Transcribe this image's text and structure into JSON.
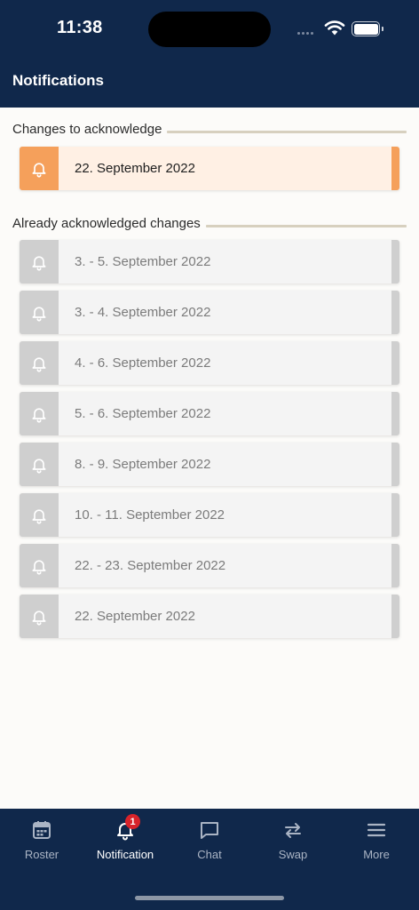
{
  "status_bar": {
    "time": "11:38"
  },
  "header": {
    "title": "Notifications"
  },
  "sections": {
    "pending": {
      "title": "Changes to acknowledge",
      "items": [
        {
          "label": "22. September 2022"
        }
      ]
    },
    "acknowledged": {
      "title": "Already acknowledged changes",
      "items": [
        {
          "label": "3. - 5. September 2022"
        },
        {
          "label": "3. - 4. September 2022"
        },
        {
          "label": "4. - 6. September 2022"
        },
        {
          "label": "5. - 6. September 2022"
        },
        {
          "label": "8. - 9. September 2022"
        },
        {
          "label": "10. - 11. September 2022"
        },
        {
          "label": "22. - 23. September 2022"
        },
        {
          "label": "22. September 2022"
        }
      ]
    }
  },
  "tab_bar": {
    "tabs": [
      {
        "label": "Roster",
        "icon": "calendar-icon",
        "active": false
      },
      {
        "label": "Notification",
        "icon": "bell-icon",
        "active": true,
        "badge": "1"
      },
      {
        "label": "Chat",
        "icon": "chat-bubble-icon",
        "active": false
      },
      {
        "label": "Swap",
        "icon": "swap-arrows-icon",
        "active": false
      },
      {
        "label": "More",
        "icon": "menu-icon",
        "active": false
      }
    ]
  },
  "colors": {
    "navy": "#10284b",
    "pending_accent": "#f5a05b",
    "pending_bg": "#fff0e4",
    "acknowledged_accent": "#cfcfcf",
    "acknowledged_bg": "#f4f4f4",
    "badge": "#d8232a"
  }
}
